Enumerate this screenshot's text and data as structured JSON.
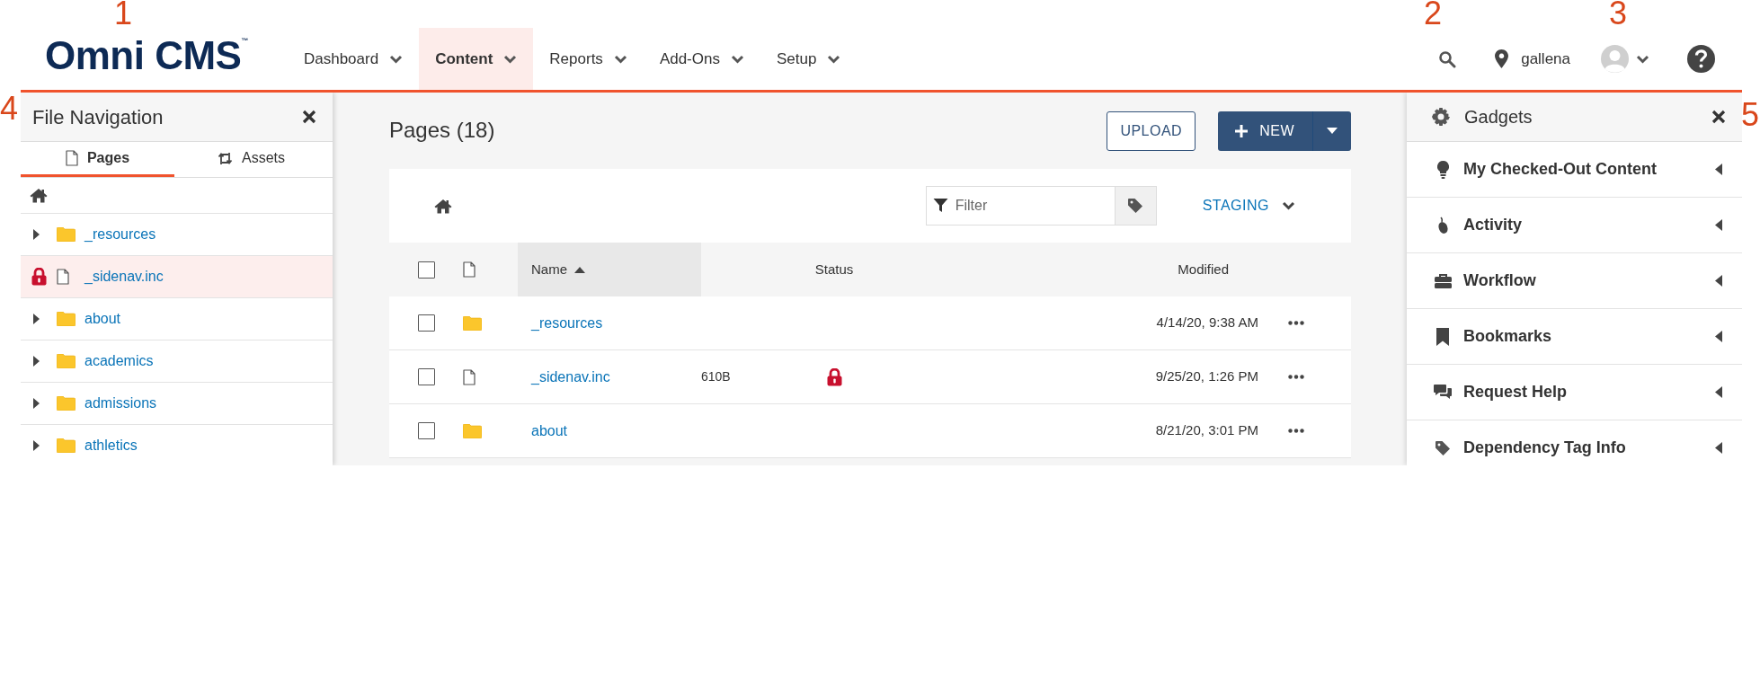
{
  "callouts": [
    {
      "label": "1"
    },
    {
      "label": "2"
    },
    {
      "label": "3"
    },
    {
      "label": "4"
    },
    {
      "label": "5"
    }
  ],
  "header": {
    "logo": "Omni CMS$^{™}$",
    "nav": [
      {
        "label": "Dashboard",
        "selected": false
      },
      {
        "label": "Content",
        "selected": true
      },
      {
        "label": "Reports",
        "selected": false
      },
      {
        "label": "Add-Ons",
        "selected": false
      },
      {
        "label": "Setup",
        "selected": false
      }
    ],
    "user": "gallena"
  },
  "file_navigation": {
    "title": "File Navigation",
    "tabs": [
      {
        "label": "Pages",
        "selected": true
      },
      {
        "label": "Assets",
        "selected": false
      }
    ],
    "items": [
      {
        "name": "_resources",
        "kind": "folder",
        "locked": false
      },
      {
        "name": "_sidenav.inc",
        "kind": "file",
        "locked": true
      },
      {
        "name": "about",
        "kind": "folder",
        "locked": false
      },
      {
        "name": "academics",
        "kind": "folder",
        "locked": false
      },
      {
        "name": "admissions",
        "kind": "folder",
        "locked": false
      },
      {
        "name": "athletics",
        "kind": "folder",
        "locked": false
      }
    ]
  },
  "pages": {
    "title": "Pages (18)",
    "upload": "UPLOAD",
    "new": "NEW",
    "filter_placeholder": "Filter",
    "environment": "STAGING",
    "all_checked": false,
    "columns": {
      "name": "Name",
      "status": "Status",
      "modified": "Modified"
    },
    "name_sort_ascending": true,
    "rows": [
      {
        "name": "_resources",
        "kind": "folder",
        "checked": false,
        "locked": false,
        "modified": "4/14/20, 9:38 AM"
      },
      {
        "name": "_sidenav.inc",
        "kind": "file",
        "checked": false,
        "size": "610B",
        "locked": true,
        "modified": "9/25/20, 1:26 PM"
      },
      {
        "name": "about",
        "kind": "folder",
        "checked": false,
        "locked": false,
        "modified": "8/21/20, 3:01 PM"
      }
    ]
  },
  "gadgets": {
    "title": "Gadgets",
    "items": [
      {
        "label": "My Checked-Out Content",
        "expanded": false
      },
      {
        "label": "Activity",
        "expanded": false
      },
      {
        "label": "Workflow",
        "expanded": false
      },
      {
        "label": "Bookmarks",
        "expanded": false
      },
      {
        "label": "Request Help",
        "expanded": false
      },
      {
        "label": "Dependency Tag Info",
        "expanded": false
      }
    ]
  }
}
